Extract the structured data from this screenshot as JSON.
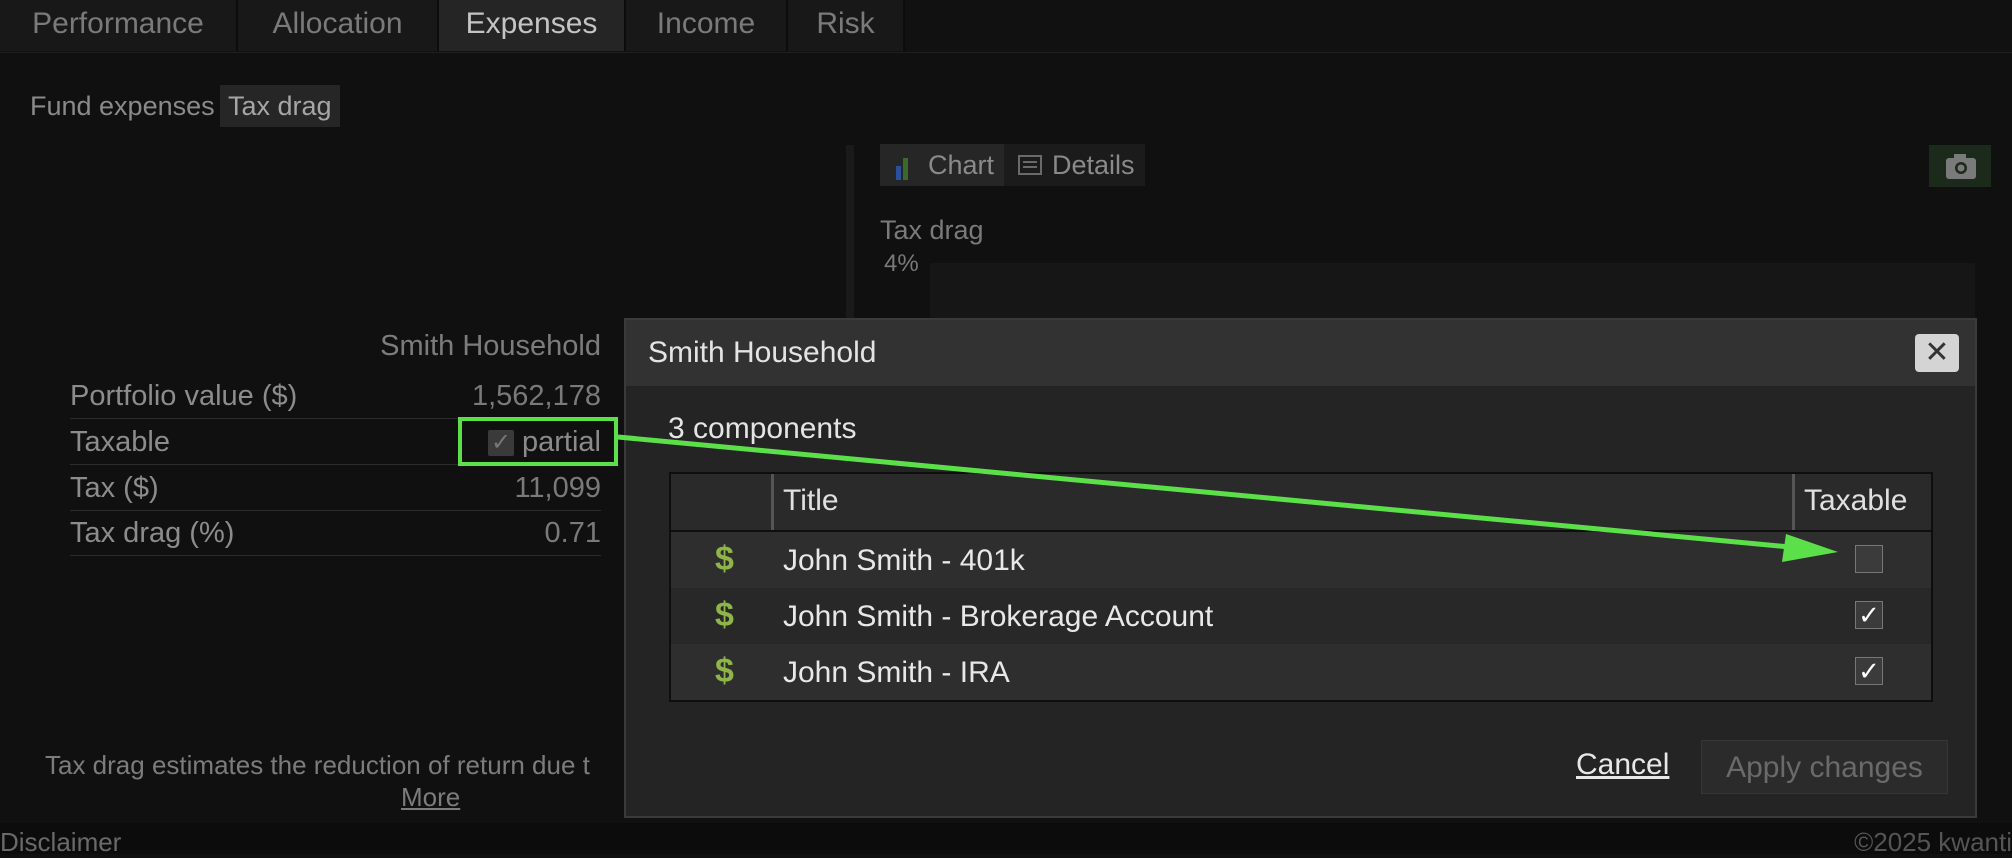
{
  "tabs": [
    "Performance",
    "Allocation",
    "Expenses",
    "Income",
    "Risk"
  ],
  "subtabs": [
    "Fund expenses",
    "Tax drag"
  ],
  "summary": {
    "header": "Smith Household",
    "rows": [
      {
        "label": "Portfolio value ($)",
        "value": "1,562,178"
      },
      {
        "label": "Taxable",
        "value": "partial"
      },
      {
        "label": "Tax ($)",
        "value": "11,099"
      },
      {
        "label": "Tax drag (%)",
        "value": "0.71"
      }
    ],
    "footnote": "Tax drag estimates the reduction of return due t",
    "more_link": "More"
  },
  "chart_panel": {
    "chart_btn": "Chart",
    "details_btn": "Details",
    "label": "Tax drag",
    "tick": "4%"
  },
  "dialog": {
    "title": "Smith Household",
    "count": "3 components",
    "columns": {
      "title": "Title",
      "taxable": "Taxable"
    },
    "rows": [
      {
        "title": "John Smith - 401k",
        "taxable": false
      },
      {
        "title": "John Smith - Brokerage Account",
        "taxable": true
      },
      {
        "title": "John Smith - IRA",
        "taxable": true
      }
    ],
    "cancel": "Cancel",
    "apply": "Apply changes"
  },
  "footer": {
    "disclaimer": "Disclaimer",
    "copyright": "©2025 kwanti"
  },
  "colors": {
    "highlight": "#5ce04a",
    "dollar": "#8fb54a",
    "accent_blue": "#2a4f9c"
  }
}
